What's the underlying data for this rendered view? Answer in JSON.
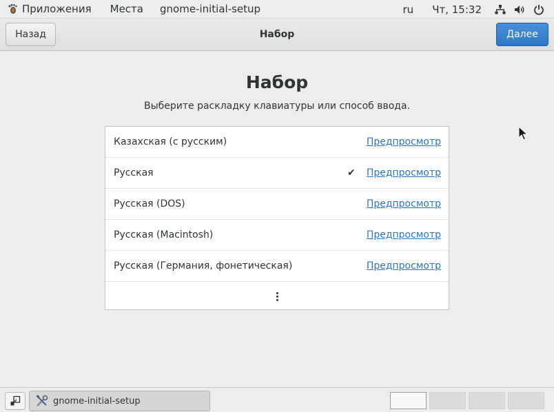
{
  "top_panel": {
    "apps_label": "Приложения",
    "places_label": "Места",
    "app_menu_label": "gnome-initial-setup",
    "language": "ru",
    "clock": "Чт, 15:32"
  },
  "header": {
    "back_label": "Назад",
    "title": "Набор",
    "next_label": "Далее"
  },
  "main": {
    "title": "Набор",
    "subtitle": "Выберите раскладку клавиатуры или способ ввода.",
    "layouts": [
      {
        "name": "Казахская (с русским)",
        "selected": false,
        "preview": "Предпросмотр"
      },
      {
        "name": "Русская",
        "selected": true,
        "preview": "Предпросмотр"
      },
      {
        "name": "Русская (DOS)",
        "selected": false,
        "preview": "Предпросмотр"
      },
      {
        "name": "Русская (Macintosh)",
        "selected": false,
        "preview": "Предпросмотр"
      },
      {
        "name": "Русская (Германия, фонетическая)",
        "selected": false,
        "preview": "Предпросмотр"
      }
    ]
  },
  "taskbar": {
    "window_title": "gnome-initial-setup",
    "workspaces": 4,
    "active_workspace": 1
  },
  "colors": {
    "accent": "#2f76c4",
    "link": "#2a76c6",
    "background": "#ededed"
  }
}
